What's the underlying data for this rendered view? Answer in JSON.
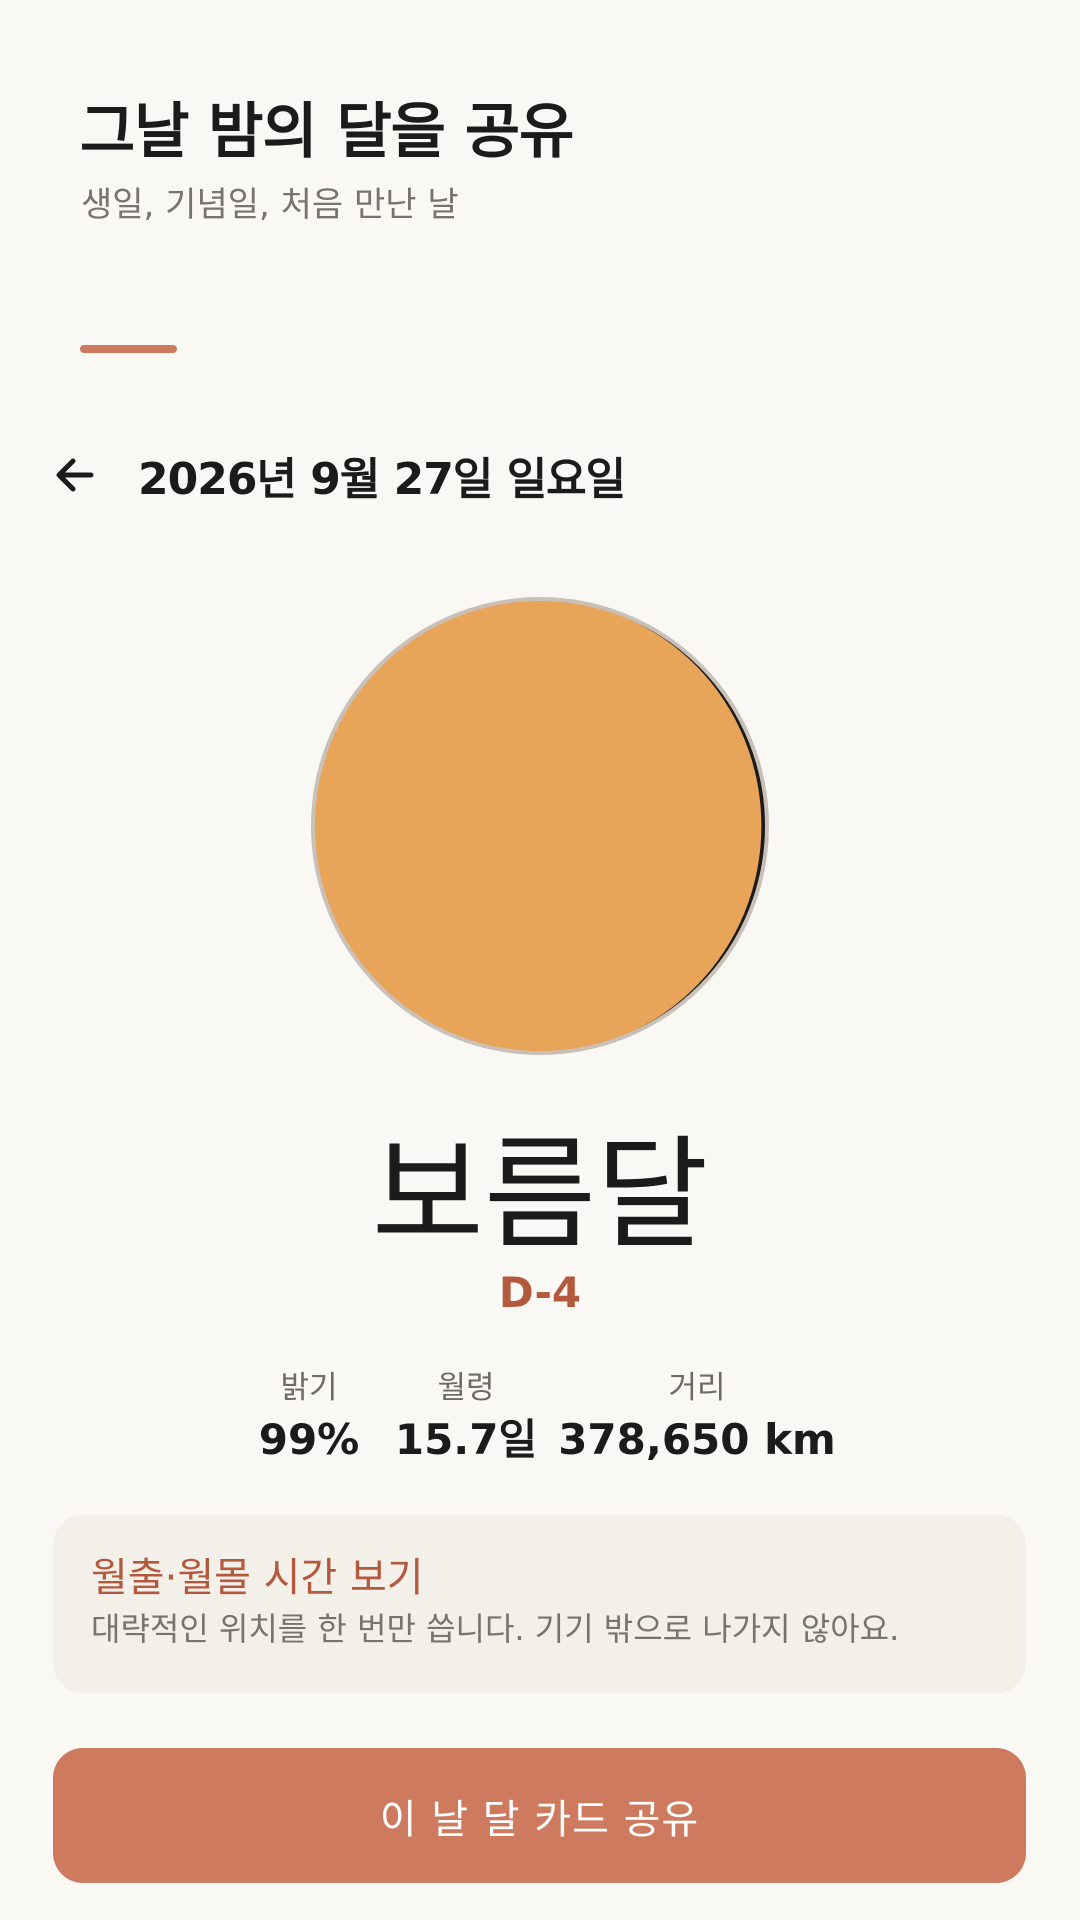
{
  "header": {
    "title": "그날 밤의 달을 공유",
    "subtitle": "생일, 기념일, 처음 만난 날"
  },
  "date_bar": {
    "back_icon": "arrow-left-icon",
    "date": "2026년 9월 27일 일요일"
  },
  "moon": {
    "phase_name": "보름달",
    "illumination_fraction": 0.99,
    "lit_color": "#e8a458",
    "rim_color": "#c9c1b8",
    "shadow_color": "#1c1b19"
  },
  "countdown": "D-4",
  "stats": [
    {
      "label": "밝기",
      "value": "99%"
    },
    {
      "label": "월령",
      "value": "15.7일"
    },
    {
      "label": "거리",
      "value": "378,650 km"
    }
  ],
  "location_card": {
    "title": "월출·월몰 시간 보기",
    "description": "대략적인 위치를 한 번만 씁니다. 기기 밖으로 나가지 않아요."
  },
  "share_button": {
    "label": "이 날 달 카드 공유"
  },
  "colors": {
    "background": "#faf8f5",
    "accent": "#cd7a5f",
    "accent_text": "#b35a3e",
    "card_background": "#f3efe9"
  }
}
